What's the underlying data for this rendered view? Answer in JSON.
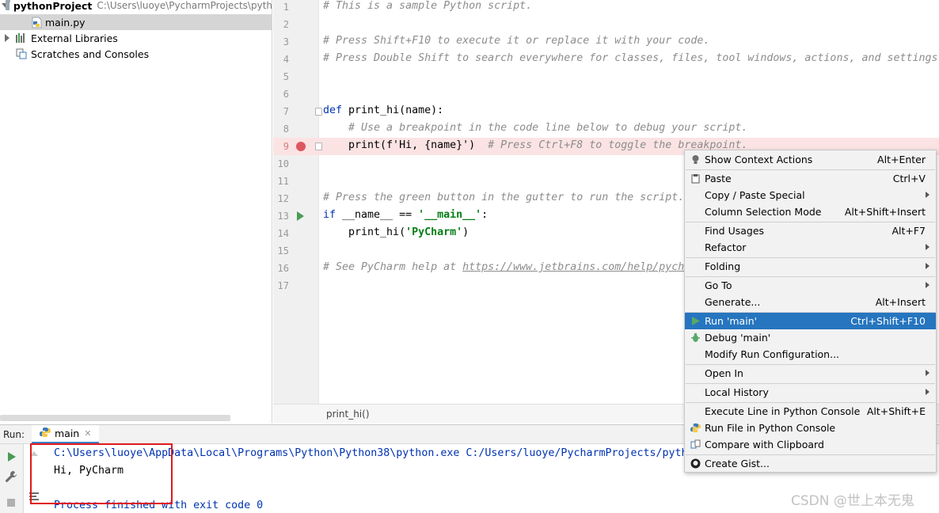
{
  "project_tree": {
    "root_name": "pythonProject",
    "root_path": "C:\\Users\\luoye\\PycharmProjects\\pyth",
    "file": "main.py",
    "external_libraries": "External Libraries",
    "scratches": "Scratches and Consoles"
  },
  "editor": {
    "lines": [
      {
        "n": "1",
        "text": "# This is a sample Python script."
      },
      {
        "n": "2",
        "text": ""
      },
      {
        "n": "3",
        "text": "# Press Shift+F10 to execute it or replace it with your code."
      },
      {
        "n": "4",
        "text": "# Press Double Shift to search everywhere for classes, files, tool windows, actions, and settings"
      },
      {
        "n": "5",
        "text": ""
      },
      {
        "n": "6",
        "text": ""
      },
      {
        "n": "7",
        "kw": "def",
        "rest": " print_hi(name):"
      },
      {
        "n": "8",
        "text": "    # Use a breakpoint in the code line below to debug your script."
      },
      {
        "n": "9",
        "code_a": "    print(f'Hi, {name}')",
        "comment": "  # Press Ctrl+F8 to toggle the breakpoint."
      },
      {
        "n": "10",
        "text": ""
      },
      {
        "n": "11",
        "text": ""
      },
      {
        "n": "12",
        "text": "# Press the green button in the gutter to run the script."
      },
      {
        "n": "13",
        "kw": "if",
        "rest": " __name__ == ",
        "str": "'__main__'",
        "end": ":"
      },
      {
        "n": "14",
        "rest": "    print_hi(",
        "str": "'PyCharm'",
        "end": ")"
      },
      {
        "n": "15",
        "text": ""
      },
      {
        "n": "16",
        "prefix": "# See PyCharm help at ",
        "link": "https://www.jetbrains.com/help/pych"
      },
      {
        "n": "17",
        "text": ""
      }
    ],
    "breadcrumb": "print_hi()"
  },
  "run_panel": {
    "label": "Run:",
    "tab_name": "main",
    "console": {
      "command": "C:\\Users\\luoye\\AppData\\Local\\Programs\\Python\\Python38\\python.exe C:/Users/luoye/PycharmProjects/pyth",
      "output": "Hi, PyCharm",
      "exit": "Process finished with exit code 0"
    }
  },
  "context_menu": {
    "items": [
      {
        "label": "Show Context Actions",
        "shortcut": "Alt+Enter",
        "icon": "bulb-icon"
      },
      {
        "label": "Paste",
        "shortcut": "Ctrl+V",
        "icon": "clipboard-icon"
      },
      {
        "label": "Copy / Paste Special",
        "submenu": true
      },
      {
        "label": "Column Selection Mode",
        "shortcut": "Alt+Shift+Insert"
      },
      {
        "label": "Find Usages",
        "shortcut": "Alt+F7"
      },
      {
        "label": "Refactor",
        "submenu": true
      },
      {
        "label": "Folding",
        "submenu": true
      },
      {
        "label": "Go To",
        "submenu": true
      },
      {
        "label": "Generate...",
        "shortcut": "Alt+Insert"
      },
      {
        "label": "Run 'main'",
        "shortcut": "Ctrl+Shift+F10",
        "icon": "run-icon",
        "active": true
      },
      {
        "label": "Debug 'main'",
        "icon": "debug-icon"
      },
      {
        "label": "Modify Run Configuration..."
      },
      {
        "label": "Open In",
        "submenu": true
      },
      {
        "label": "Local History",
        "submenu": true
      },
      {
        "label": "Execute Line in Python Console",
        "shortcut": "Alt+Shift+E"
      },
      {
        "label": "Run File in Python Console",
        "icon": "python-icon"
      },
      {
        "label": "Compare with Clipboard",
        "icon": "compare-icon"
      },
      {
        "label": "Create Gist...",
        "icon": "github-icon"
      }
    ]
  },
  "watermark": "CSDN @世上本无鬼",
  "colors": {
    "menu_active": "#2675bf",
    "breakpoint": "#db5860",
    "run_green": "#499c54",
    "highlight_box": "#e0191c"
  }
}
